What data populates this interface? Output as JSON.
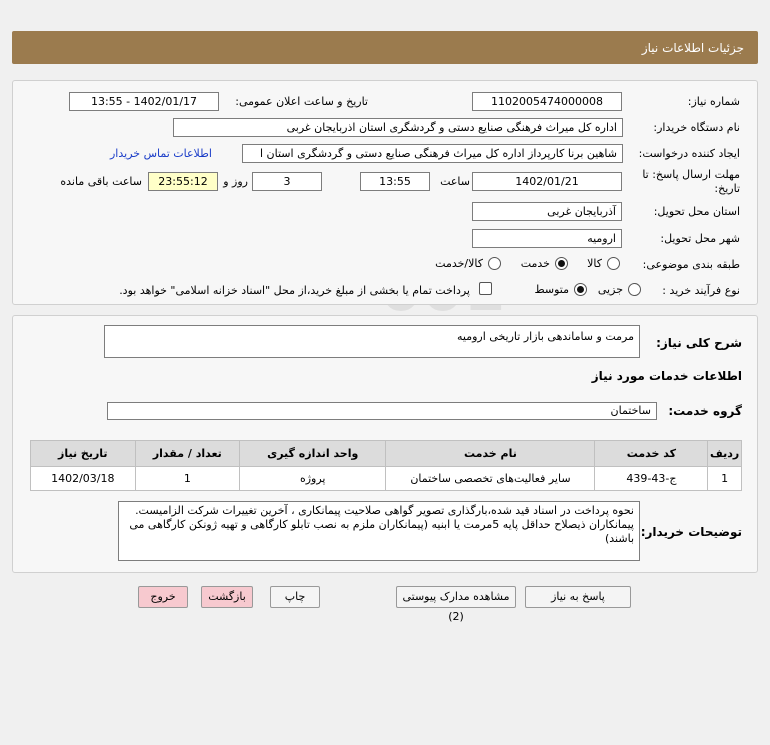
{
  "header": {
    "title": "جزئیات اطلاعات نیاز"
  },
  "form": {
    "need_number_label": "شماره نیاز:",
    "need_number": "1102005474000008",
    "announce_label": "تاریخ و ساعت اعلان عمومی:",
    "announce_value": "1402/01/17 - 13:55",
    "buyer_org_label": "نام دستگاه خریدار:",
    "buyer_org": "اداره کل میراث فرهنگی  صنایع دستی و گردشگری استان اذربایجان غربی",
    "creator_label": "ایجاد کننده درخواست:",
    "creator": "شاهین برنا کارپرداز اداره کل میراث فرهنگی  صنایع دستی و گردشگری استان ا",
    "contact_link": "اطلاعات تماس خریدار",
    "deadline_label_1": "مهلت ارسال پاسخ: تا",
    "deadline_label_2": "تاریخ:",
    "deadline_date": "1402/01/21",
    "time_label": "ساعت",
    "deadline_time": "13:55",
    "days_value": "3",
    "days_label": "روز و",
    "remaining_value": "23:55:12",
    "remaining_label": "ساعت باقی مانده",
    "province_label": "استان محل تحویل:",
    "province": "آذربایجان غربی",
    "city_label": "شهر محل تحویل:",
    "city": "ارومیه",
    "category_label": "طبقه بندی موضوعی:",
    "category_options": [
      "کالا",
      "خدمت",
      "کالا/خدمت"
    ],
    "category_selected": "خدمت",
    "process_label": "نوع فرآیند خرید :",
    "process_options": [
      "جزیی",
      "متوسط"
    ],
    "process_selected": "متوسط",
    "process_checkbox_label": "پرداخت تمام یا بخشی از مبلغ خرید،از محل \"اسناد خزانه اسلامی\" خواهد بود."
  },
  "summary": {
    "label": "شرح کلی نیاز:",
    "value": "مرمت و ساماندهی بازار تاریخی ارومیه",
    "services_title": "اطلاعات خدمات مورد نیاز",
    "group_label": "گروه خدمت:",
    "group_value": "ساختمان"
  },
  "table": {
    "headers": [
      "ردیف",
      "کد خدمت",
      "نام خدمت",
      "واحد اندازه گیری",
      "تعداد / مقدار",
      "تاریخ نیاز"
    ],
    "rows": [
      [
        "1",
        "ج-43-439",
        "سایر فعالیت‌های تخصصی ساختمان",
        "پروژه",
        "1",
        "1402/03/18"
      ]
    ]
  },
  "notes": {
    "label": "توضیحات خریدار:",
    "value": "نحوه پرداخت در اسناد قید شده،بارگذاری تصویر گواهی صلاحیت  پیمانکاری ، آخرین تغییرات شرکت الزامیست. پیمانکاران ذیصلاح حداقل پایه 5مرمت یا ابنیه (پیمانکاران ملزم به نصب تابلو کارگاهی و تهیه ژونکن کارگاهی می باشند)"
  },
  "buttons": {
    "reply": "پاسخ به نیاز",
    "docs": "مشاهده مدارک پیوستی (2)",
    "print": "چاپ",
    "back": "بازگشت",
    "exit": "خروج"
  },
  "colors": {
    "header_bg": "#9b7b4e",
    "link": "#1a3cc8",
    "exit_bg": "#f7c9cf"
  }
}
